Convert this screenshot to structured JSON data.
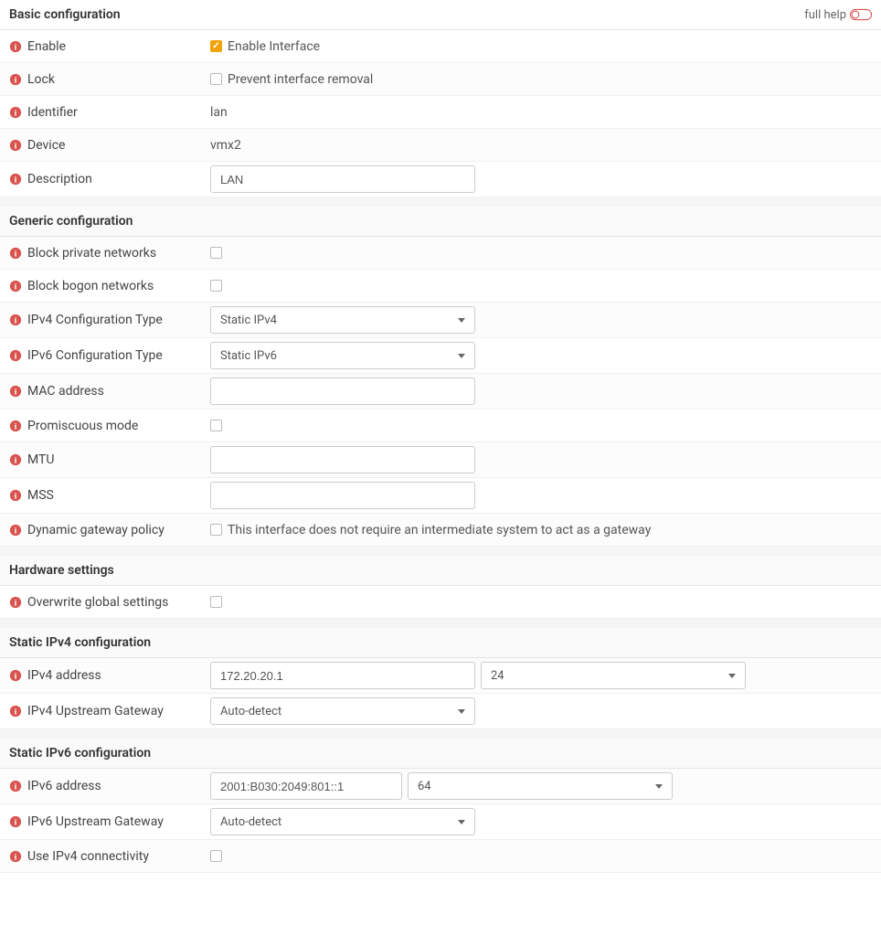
{
  "header": {
    "fullHelp": "full help"
  },
  "sections": {
    "basic": {
      "title": "Basic configuration",
      "enable": {
        "label": "Enable",
        "text": "Enable Interface",
        "checked": true
      },
      "lock": {
        "label": "Lock",
        "text": "Prevent interface removal",
        "checked": false
      },
      "identifier": {
        "label": "Identifier",
        "value": "lan"
      },
      "device": {
        "label": "Device",
        "value": "vmx2"
      },
      "description": {
        "label": "Description",
        "value": "LAN"
      }
    },
    "generic": {
      "title": "Generic configuration",
      "blockPrivate": {
        "label": "Block private networks",
        "checked": false
      },
      "blockBogon": {
        "label": "Block bogon networks",
        "checked": false
      },
      "ipv4Type": {
        "label": "IPv4 Configuration Type",
        "value": "Static IPv4"
      },
      "ipv6Type": {
        "label": "IPv6 Configuration Type",
        "value": "Static IPv6"
      },
      "mac": {
        "label": "MAC address",
        "value": ""
      },
      "promisc": {
        "label": "Promiscuous mode",
        "checked": false
      },
      "mtu": {
        "label": "MTU",
        "value": ""
      },
      "mss": {
        "label": "MSS",
        "value": ""
      },
      "dynGw": {
        "label": "Dynamic gateway policy",
        "text": "This interface does not require an intermediate system to act as a gateway",
        "checked": false
      }
    },
    "hardware": {
      "title": "Hardware settings",
      "overwrite": {
        "label": "Overwrite global settings",
        "checked": false
      }
    },
    "staticV4": {
      "title": "Static IPv4 configuration",
      "addr": {
        "label": "IPv4 address",
        "value": "172.20.20.1",
        "prefix": "24"
      },
      "gateway": {
        "label": "IPv4 Upstream Gateway",
        "value": "Auto-detect"
      }
    },
    "staticV6": {
      "title": "Static IPv6 configuration",
      "addr": {
        "label": "IPv6 address",
        "value": "2001:B030:2049:801::1",
        "prefix": "64"
      },
      "gateway": {
        "label": "IPv6 Upstream Gateway",
        "value": "Auto-detect"
      },
      "useV4": {
        "label": "Use IPv4 connectivity",
        "checked": false
      }
    }
  }
}
